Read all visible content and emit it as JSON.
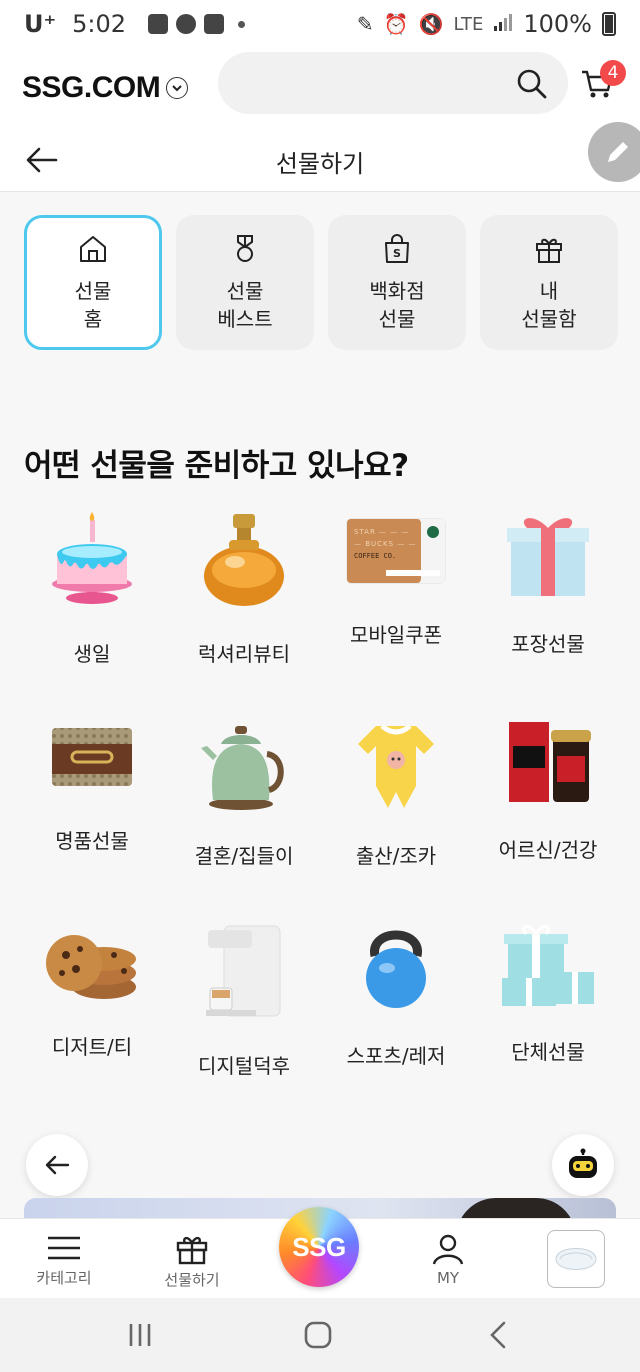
{
  "status_bar": {
    "carrier": "U⁺",
    "time": "5:02",
    "network": "LTE",
    "battery": "100%"
  },
  "header": {
    "logo": "SSG.COM",
    "cart_count": "4"
  },
  "title_bar": {
    "title": "선물하기"
  },
  "quick_menu": [
    {
      "label": "선물\n홈",
      "icon": "home-icon",
      "active": true
    },
    {
      "label": "선물\n베스트",
      "icon": "medal-icon",
      "active": false
    },
    {
      "label": "백화점\n선물",
      "icon": "shopping-bag-icon",
      "active": false
    },
    {
      "label": "내\n선물함",
      "icon": "gift-icon",
      "active": false
    }
  ],
  "section": {
    "title": "어떤 선물을 준비하고 있나요?"
  },
  "categories": [
    {
      "label": "생일",
      "image": "birthday-cake"
    },
    {
      "label": "럭셔리뷰티",
      "image": "perfume-bottle"
    },
    {
      "label": "모바일쿠폰",
      "image": "coffee-gift-card"
    },
    {
      "label": "포장선물",
      "image": "wrapped-gift-box"
    },
    {
      "label": "명품선물",
      "image": "luxury-wallet"
    },
    {
      "label": "결혼/집들이",
      "image": "electric-kettle"
    },
    {
      "label": "출산/조카",
      "image": "baby-romper"
    },
    {
      "label": "어르신/건강",
      "image": "red-ginseng-set"
    },
    {
      "label": "디저트/티",
      "image": "cookies"
    },
    {
      "label": "디지털덕후",
      "image": "coffee-machine"
    },
    {
      "label": "스포츠/레저",
      "image": "kettlebell"
    },
    {
      "label": "단체선물",
      "image": "gift-boxes-stack"
    }
  ],
  "coupon_card": {
    "text": "COFFEE CO."
  },
  "bottom_nav": {
    "category": "카테고리",
    "gift": "선물하기",
    "center": "SSG",
    "my": "MY"
  },
  "colors": {
    "accent": "#4fc8ee",
    "badge": "#f24a4a"
  }
}
